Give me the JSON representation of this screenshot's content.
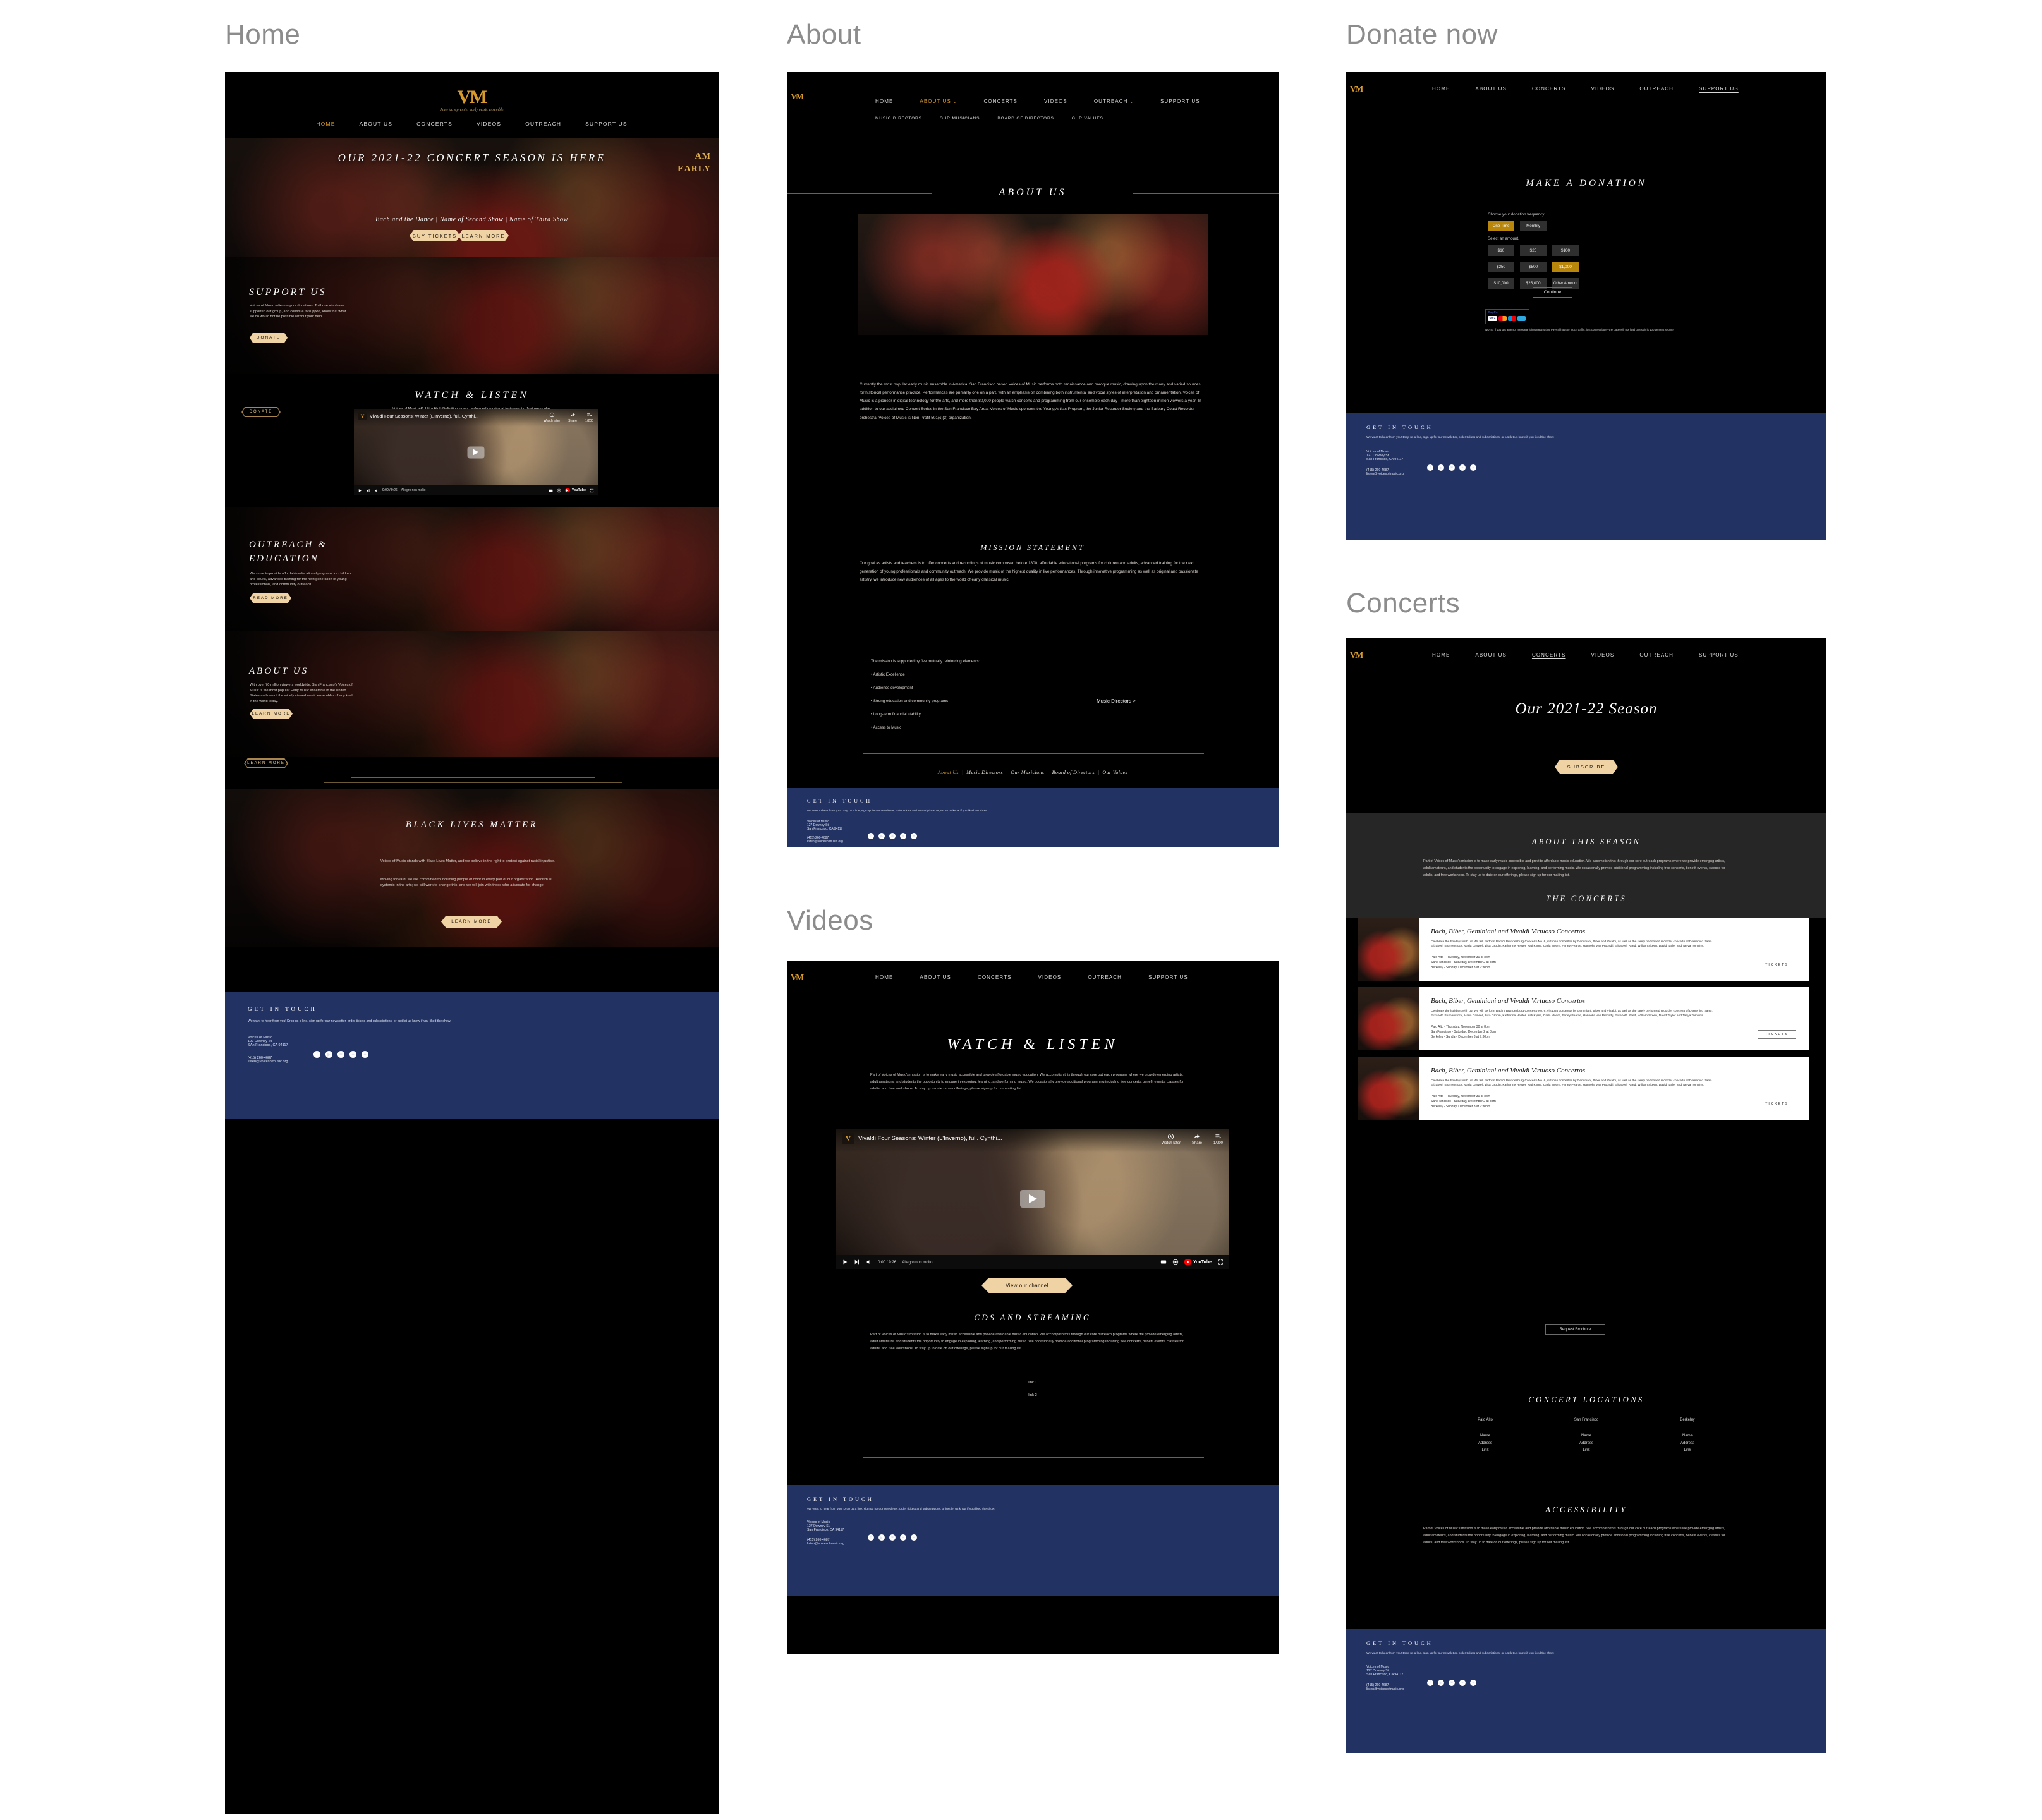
{
  "brand": {
    "logo_text": "VM",
    "tagline": "America's premier early music ensemble",
    "accent": "#d79a2b",
    "button_fill": "#f0d3a4",
    "footer_bg": "#223263"
  },
  "labels": {
    "home": "Home",
    "about": "About",
    "donate": "Donate now",
    "videos": "Videos",
    "concerts": "Concerts"
  },
  "nav": {
    "items": [
      "HOME",
      "ABOUT US",
      "CONCERTS",
      "VIDEOS",
      "OUTREACH",
      "SUPPORT US"
    ],
    "about_sub": [
      "MUSIC DIRECTORS",
      "OUR MUSICIANS",
      "BOARD OF DIRECTORS",
      "OUR VALUES"
    ]
  },
  "home": {
    "hero": {
      "headline": "OUR 2021-22 CONCERT SEASON IS HERE",
      "side_text_1": "AM",
      "side_text_2": "EARLY",
      "shows": "Bach and the Dance  |  Name of Second Show  |  Name of Third Show",
      "buy_tickets": "BUY TICKETS",
      "learn_more": "LEARN MORE"
    },
    "support": {
      "title": "SUPPORT US",
      "body": "Voices of Music relies on your donations. To those who have supported our group, and continue to support, know that what we do would not be possible without your help.",
      "cta": "DONATE"
    },
    "watch": {
      "title": "WATCH & LISTEN",
      "sub": "Voices of Music 4K, Ultra High Definition video, performed on original instruments. Just press play.",
      "donate": "DONATE"
    },
    "outreach": {
      "title": "OUTREACH &\nEDUCATION",
      "body": "We strive to provide affordable educational programs for children and adults, advanced training for the next generation of young professionals, and community outreach.",
      "cta": "READ MORE"
    },
    "about": {
      "title": "ABOUT US",
      "body": "With over 70 million viewers worldwide, San Francisco's Voices of Music is the most popular Early Music ensemble in the United States and one of the widely viewed music ensembles of any kind in the world today.",
      "cta": "LEARN MORE",
      "cta2": "LEARN MORE"
    },
    "blm": {
      "title": "BLACK LIVES MATTER",
      "para1": "Voices of Music stands with Black Lives Matter, and we believe in the right to protest against racial injustice.",
      "para2": "Moving forward, we are committed to including people of color in every part of our organization. Racism is systemic in the arts; we will work to change this, and we will join with those who advocate for change.",
      "cta": "LEARN MORE"
    }
  },
  "video_player": {
    "title": "Vivaldi Four Seasons: Winter (L'Inverno), full. Cynthi...",
    "watch_later": "Watch later",
    "share": "Share",
    "count": "1/200",
    "time": "0:00 / 9:26",
    "chapter": "Allegro non molto",
    "youtube": "YouTube"
  },
  "about_page": {
    "title": "ABOUT US",
    "body": "Currently the most popular early music ensemble in America, San Francisco based Voices of Music performs both renaissance and baroque music, drawing upon the many and varied sources for historical performance practice. Performances are primarily one on a part, with an emphasis on combining both instrumental and vocal styles of interpretation and ornamentation. Voices of Music is a pioneer in digital technology for the arts, and more than 80,000 people watch concerts and programming from our ensemble each day—more than eighteen million viewers a year. In addition to our acclaimed Concert Series in the San Francisco Bay Area, Voices of Music sponsors the Young Artists Program, the Junior Recorder Society and the Barbary Coast Recorder orchestra. Voices of Music is Non-Profit 501(c)(3) organization.",
    "mission_title": "MISSION STATEMENT",
    "mission_body": "Our goal as artists and teachers is to offer concerts and recordings of music composed before 1800, affordable educational programs for children and adults, advanced training for the next generation of young professionals and community outreach. We provide music of the highest quality in live performances. Through innovative programming as well as original and passionate artistry, we introduce new audiences of all ages to the world of early classical music.",
    "elements_intro": "The mission is supported by five mutually reinforcing elements:",
    "elements": [
      "• Artistic Excellence",
      "• Audience development",
      "• Strong education and community programs",
      "• Long-term financial stability",
      "• Access to Music"
    ],
    "music_directors_link": "Music Directors >",
    "bottom_links": [
      "About Us",
      "Music Directors",
      "Our Musicians",
      "Board of Directors",
      "Our Values"
    ]
  },
  "donate_page": {
    "title": "MAKE A DONATION",
    "frequency_label": "Choose your donation frequency.",
    "frequency_options": [
      "One Time",
      "Monthly"
    ],
    "frequency_selected": "One Time",
    "amount_label": "Select an amount.",
    "amounts": [
      "$10",
      "$25",
      "$100",
      "$250",
      "$500",
      "$1,000",
      "$10,000",
      "$25,000",
      "Other Amount"
    ],
    "amount_selected": "$1,000",
    "continue": "Continue",
    "paypal_brand": "PayPal",
    "cards": [
      "VISA",
      "mastercard",
      "Maestro",
      "card"
    ],
    "note": "NOTE: If you get an error message it just means that PayPal has too much traffic, just connect later--the page will not load unless it is 100 percent secure."
  },
  "videos_page": {
    "title": "WATCH & LISTEN",
    "intro": "Part of Voices of Music's mission is to make early music accessible and provide affordable music education. We accomplish this through our core outreach programs where we provide emerging artists, adult amateurs, and students the opportunity to engage in exploring, learning, and performing music. We occasionally provide additional programming including free concerts, benefit events, classes for adults, and free workshops. To stay up to date on our offerings, please sign up for our mailing list.",
    "channel_cta": "View our channel",
    "cds_title": "CDS AND STREAMING",
    "cds_body": "Part of Voices of Music's mission is to make early music accessible and provide affordable music education. We accomplish this through our core outreach programs where we provide emerging artists, adult amateurs, and students the opportunity to engage in exploring, learning, and performing music. We occasionally provide additional programming including free concerts, benefit events, classes for adults, and free workshops. To stay up to date on our offerings, please sign up for our mailing list.",
    "links": [
      "link 1",
      "link 2"
    ]
  },
  "concerts_page": {
    "season_title": "Our 2021-22 Season",
    "subscribe": "SUBSCRIBE",
    "about_season_title": "ABOUT THIS SEASON",
    "about_season_body": "Part of Voices of Music's mission is to make early music accessible and provide affordable music education. We accomplish this through our core outreach programs where we provide emerging artists, adult amateurs, and students the opportunity to engage in exploring, learning, and performing music. We occasionally provide additional programming including free concerts, benefit events, classes for adults, and free workshops. To stay up to date on our offerings, please sign up for our mailing list.",
    "concerts_title": "THE CONCERTS",
    "concert": {
      "title": "Bach, Biber, Geminiani and Vivaldi Virtuoso Concertos",
      "desc": "Celebrate the holidays with us! We will perform Bach's Brandenburg Concerto No. 6, virtuoso concertos by Geminiani, Biber and Vivaldi, as well as the rarely performed recorder concerto of Domenico Sarro. Elizabeth Blumenstock, Maria Caswell, Lisa Grodin, Katherine Heater, Kati Kyme, Carla Moore, Farley Pearce, Hanneke van Proosdij, Elisabeth Reed, William Skeen, David Tayler and Tanya Tomkins.",
      "dates": [
        "Palo Alto - Thursday, November 30 at 8pm",
        "San Francisco - Saturday, December 2 at 8pm",
        "Berkeley - Sunday, December 3 at 7:30pm"
      ],
      "tickets": "TICKETS"
    },
    "request_brochure": "Request Brochure",
    "locations_title": "CONCERT LOCATIONS",
    "locations": [
      {
        "city": "Palo Alto",
        "name": "Name",
        "address": "Address",
        "link": "Link"
      },
      {
        "city": "San Francisco",
        "name": "Name",
        "address": "Address",
        "link": "Link"
      },
      {
        "city": "Berkeley",
        "name": "Name",
        "address": "Address",
        "link": "Link"
      }
    ],
    "accessibility_title": "ACCESSIBILITY",
    "accessibility_body": "Part of Voices of Music's mission is to make early music accessible and provide affordable music education. We accomplish this through our core outreach programs where we provide emerging artists, adult amateurs, and students the opportunity to engage in exploring, learning, and performing music. We occasionally provide additional programming including free concerts, benefit events, classes for adults, and free workshops. To stay up to date on our offerings, please sign up for our mailing list."
  },
  "footer": {
    "heading": "GET IN TOUCH",
    "tagline": "We want to hear from you! Drop us a line, sign up for our newsletter, order tickets and subscriptions, or just let us know if you liked the show.",
    "org": "Voices of Music",
    "street": "127 Downey St.",
    "city": "SAn Francisco, CA 94117",
    "city_alt": "San Francisco, CA 94117",
    "phone": "(415) 260-4687",
    "email": "listen@voicesofmusic.org",
    "socials": [
      "facebook",
      "youtube",
      "instagram",
      "twitter",
      "vimeo"
    ]
  }
}
